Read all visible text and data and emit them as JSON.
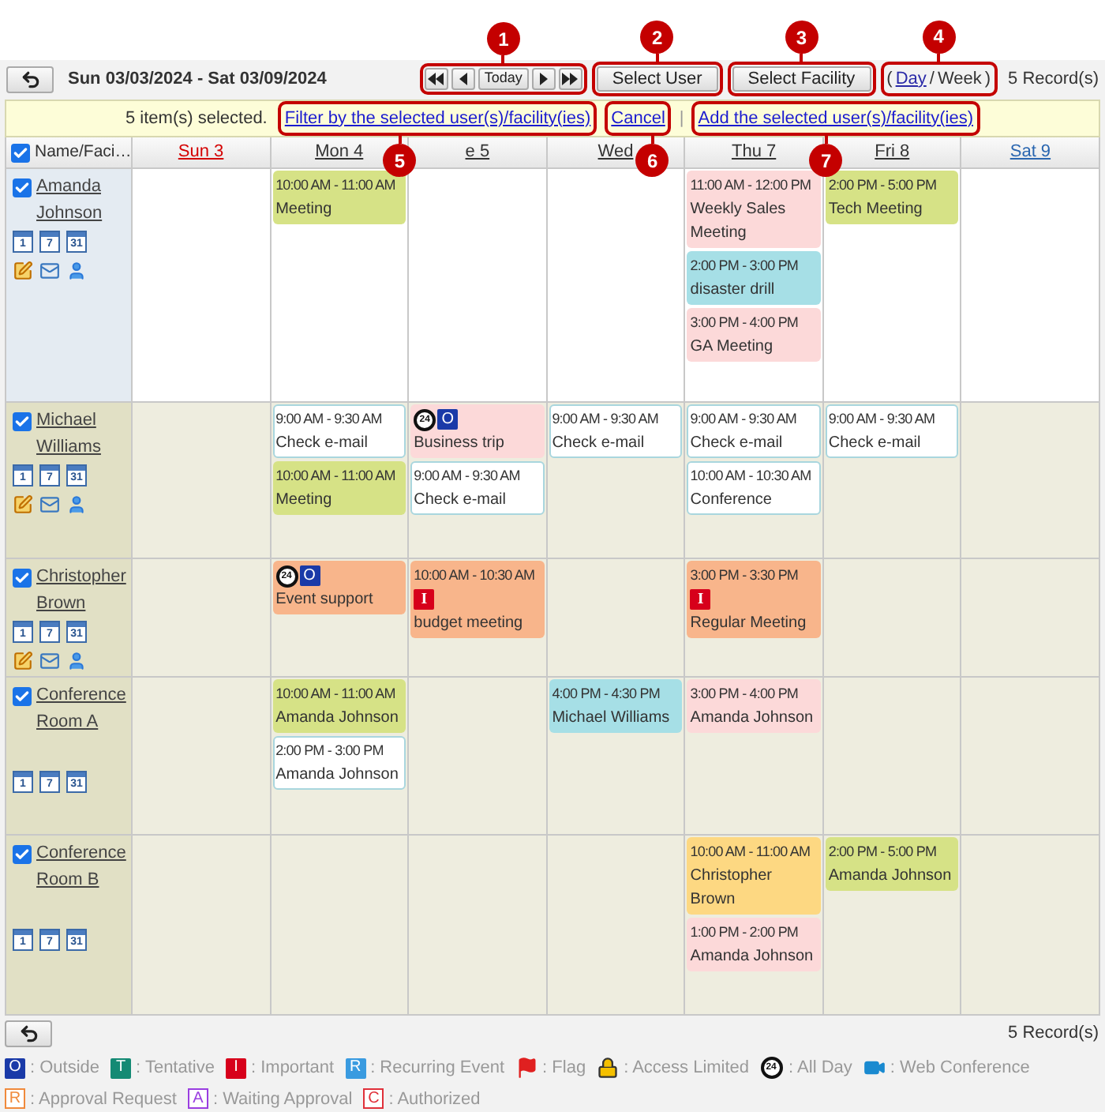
{
  "toolbar": {
    "date_range": "Sun 03/03/2024 - Sat 03/09/2024",
    "nav": {
      "callout": "1",
      "today": "Today"
    },
    "select_user": {
      "label": "Select User",
      "callout": "2"
    },
    "select_facility": {
      "label": "Select Facility",
      "callout": "3"
    },
    "view_switch": {
      "callout": "4",
      "open": "(",
      "day": "Day",
      "sep": "/",
      "week": "Week",
      "close": ")"
    },
    "records": "5 Record(s)"
  },
  "selection_bar": {
    "count": "5 item(s) selected.",
    "filter": {
      "label": "Filter by the selected user(s)/facility(ies)",
      "callout": "5"
    },
    "cancel": {
      "label": "Cancel",
      "callout": "6"
    },
    "sep": "|",
    "add": {
      "label": "Add the selected user(s)/facility(ies)",
      "callout": "7"
    }
  },
  "header": {
    "checked": true,
    "name_label": "Name/Faci…",
    "days": [
      {
        "label": "Sun 3",
        "kind": "sun"
      },
      {
        "label": "Mon 4",
        "kind": "weekday"
      },
      {
        "label": "e 5",
        "kind": "weekday"
      },
      {
        "label": "Wed",
        "kind": "weekday"
      },
      {
        "label": "Thu 7",
        "kind": "weekday"
      },
      {
        "label": "Fri 8",
        "kind": "weekday"
      },
      {
        "label": "Sat 9",
        "kind": "sat"
      }
    ]
  },
  "rows": [
    {
      "name": "Amanda Johnson",
      "kind": "user",
      "checked": true,
      "highlighted": true,
      "views": [
        "1",
        "7",
        "31"
      ],
      "days": {
        "mon": [
          {
            "time": "10:00 AM - 11:00 AM",
            "title": "Meeting",
            "color": "#d6e286"
          }
        ],
        "thu": [
          {
            "time": "11:00 AM - 12:00 PM",
            "title": "Weekly Sales Meeting",
            "color": "#fcd9d9"
          },
          {
            "time": "2:00 PM - 3:00 PM",
            "title": "disaster drill",
            "color": "#a6dfe6"
          },
          {
            "time": "3:00 PM - 4:00 PM",
            "title": "GA Meeting",
            "color": "#fcd9d9"
          }
        ],
        "fri": [
          {
            "time": "2:00 PM - 5:00 PM",
            "title": "Tech Meeting",
            "color": "#d6e286"
          }
        ]
      }
    },
    {
      "name": "Michael Williams",
      "kind": "user",
      "checked": true,
      "highlighted": false,
      "views": [
        "1",
        "7",
        "31"
      ],
      "days": {
        "mon": [
          {
            "time": "9:00 AM - 9:30 AM",
            "title": "Check e-mail",
            "color": "#ffffff"
          },
          {
            "time": "10:00 AM - 11:00 AM",
            "title": "Meeting",
            "color": "#d6e286"
          }
        ],
        "tue": [
          {
            "title": "Business trip",
            "color": "#fcd9d9",
            "marks": [
              {
                "kind": "all_day",
                "glyph": "24"
              },
              {
                "kind": "outside",
                "letter": "O"
              }
            ]
          },
          {
            "time": "9:00 AM - 9:30 AM",
            "title": "Check e-mail",
            "color": "#ffffff"
          }
        ],
        "wed": [
          {
            "time": "9:00 AM - 9:30 AM",
            "title": "Check e-mail",
            "color": "#ffffff"
          }
        ],
        "thu": [
          {
            "time": "9:00 AM - 9:30 AM",
            "title": "Check e-mail",
            "color": "#ffffff"
          },
          {
            "time": "10:00 AM - 10:30 AM",
            "title": "Conference",
            "color": "#ffffff"
          }
        ],
        "fri": [
          {
            "time": "9:00 AM - 9:30 AM",
            "title": "Check e-mail",
            "color": "#ffffff"
          }
        ]
      }
    },
    {
      "name": "Christopher Brown",
      "kind": "user",
      "checked": true,
      "highlighted": false,
      "views": [
        "1",
        "7",
        "31"
      ],
      "days": {
        "mon": [
          {
            "title": "Event support",
            "color": "#f8b58b",
            "marks": [
              {
                "kind": "all_day",
                "glyph": "24"
              },
              {
                "kind": "outside",
                "letter": "O"
              }
            ]
          }
        ],
        "tue": [
          {
            "time": "10:00 AM - 10:30 AM",
            "title": "budget meeting",
            "color": "#f8b58b",
            "marks": [
              {
                "kind": "important",
                "letter": "I"
              }
            ]
          }
        ],
        "thu": [
          {
            "time": "3:00 PM - 3:30 PM",
            "title": "Regular Meeting",
            "color": "#f8b58b",
            "marks": [
              {
                "kind": "important",
                "letter": "I"
              }
            ]
          }
        ]
      }
    },
    {
      "name": "Conference Room A",
      "kind": "facility",
      "checked": true,
      "highlighted": false,
      "views": [
        "1",
        "7",
        "31"
      ],
      "days": {
        "mon": [
          {
            "time": "10:00 AM - 11:00 AM",
            "title": "Amanda Johnson",
            "color": "#d6e286"
          },
          {
            "time": "2:00 PM - 3:00 PM",
            "title": "Amanda Johnson",
            "color": "#ffffff"
          }
        ],
        "wed": [
          {
            "time": "4:00 PM - 4:30 PM",
            "title": "Michael Williams",
            "color": "#a6dfe6"
          }
        ],
        "thu": [
          {
            "time": "3:00 PM - 4:00 PM",
            "title": "Amanda Johnson",
            "color": "#fcd9d9"
          }
        ]
      }
    },
    {
      "name": "Conference Room B",
      "kind": "facility",
      "checked": true,
      "highlighted": false,
      "views": [
        "1",
        "7",
        "31"
      ],
      "days": {
        "thu": [
          {
            "time": "10:00 AM - 11:00 AM",
            "title": "Christopher Brown",
            "color": "#fdd882"
          },
          {
            "time": "1:00 PM - 2:00 PM",
            "title": "Amanda Johnson",
            "color": "#fcd9d9"
          }
        ],
        "fri": [
          {
            "time": "2:00 PM - 5:00 PM",
            "title": "Amanda Johnson",
            "color": "#d6e286"
          }
        ]
      }
    }
  ],
  "footer": {
    "records": "5 Record(s)"
  },
  "legend": [
    {
      "kind": "solid_letter",
      "letter": "O",
      "color": "#1a3aa8",
      "label": ": Outside"
    },
    {
      "kind": "solid_letter",
      "letter": "T",
      "color": "#148a74",
      "label": ": Tentative"
    },
    {
      "kind": "solid_letter",
      "letter": "I",
      "color": "#d7001b",
      "label": ": Important"
    },
    {
      "kind": "solid_letter",
      "letter": "R",
      "color": "#3a9be0",
      "label": ": Recurring Event"
    },
    {
      "kind": "flag",
      "label": ": Flag"
    },
    {
      "kind": "lock",
      "label": ": Access Limited"
    },
    {
      "kind": "all_day",
      "glyph": "24",
      "label": ": All Day"
    },
    {
      "kind": "video",
      "label": ": Web Conference"
    },
    {
      "kind": "outline_letter",
      "letter": "R",
      "color": "#f08a3c",
      "label": ": Approval Request"
    },
    {
      "kind": "outline_letter",
      "letter": "A",
      "color": "#9a3ee0",
      "label": ": Waiting Approval"
    },
    {
      "kind": "outline_letter",
      "letter": "C",
      "color": "#e0303a",
      "label": ": Authorized"
    }
  ]
}
